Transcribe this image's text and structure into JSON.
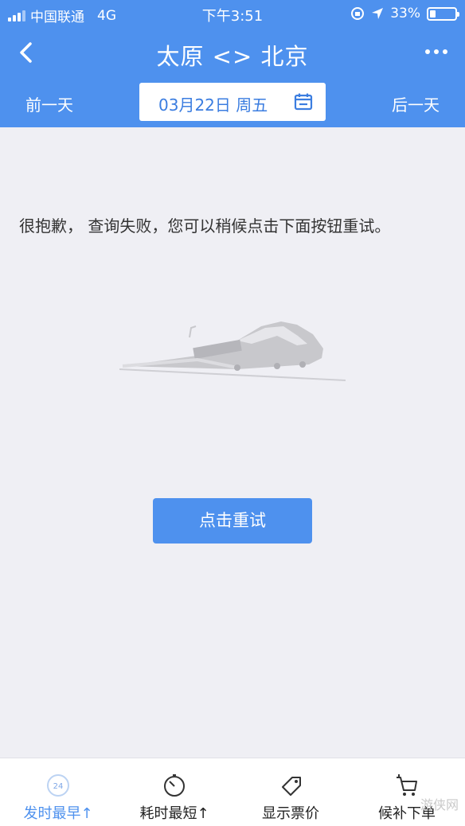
{
  "status_bar": {
    "carrier": "中国联通",
    "network": "4G",
    "time": "下午3:51",
    "battery": "33%",
    "battery_level": 0.33
  },
  "nav": {
    "title": "太原 <> 北京",
    "back_icon": "chevron-left-icon",
    "more_icon": "more-dots-icon"
  },
  "date_bar": {
    "prev_label": "前一天",
    "date_label": "03月22日 周五",
    "next_label": "后一天",
    "calendar_icon": "calendar-icon"
  },
  "main": {
    "message": "很抱歉， 查询失败，您可以稍候点击下面按钮重试。",
    "illustration": "train-icon",
    "retry_label": "点击重试"
  },
  "tabs": [
    {
      "label": "发时最早↑",
      "icon": "clock-24-icon",
      "active": true
    },
    {
      "label": "耗时最短↑",
      "icon": "stopwatch-icon",
      "active": false
    },
    {
      "label": "显示票价",
      "icon": "price-tag-icon",
      "active": false
    },
    {
      "label": "候补下单",
      "icon": "cart-icon",
      "active": false
    }
  ],
  "watermark": "游侠网",
  "colors": {
    "primary": "#4e91ee",
    "background": "#efeff4"
  }
}
